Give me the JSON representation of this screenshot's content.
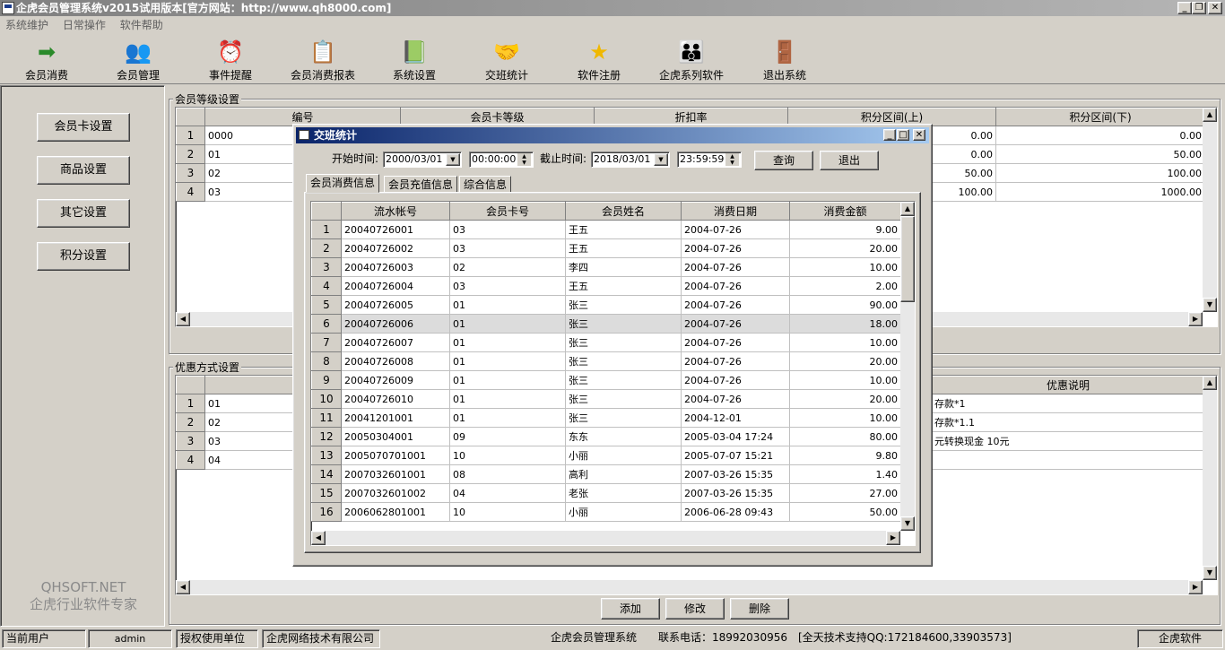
{
  "window": {
    "title": "企虎会员管理系统v2015试用版本[官方网站：http://www.qh8000.com]"
  },
  "menu": [
    "系统维护",
    "日常操作",
    "软件帮助"
  ],
  "toolbar": [
    {
      "label": "会员消费",
      "icon": "arrow-icon"
    },
    {
      "label": "会员管理",
      "icon": "users-icon"
    },
    {
      "label": "事件提醒",
      "icon": "alarm-clock-icon"
    },
    {
      "label": "会员消费报表",
      "icon": "report-icon"
    },
    {
      "label": "系统设置",
      "icon": "settings-book-icon"
    },
    {
      "label": "交班统计",
      "icon": "handshake-icon"
    },
    {
      "label": "软件注册",
      "icon": "star-icon"
    },
    {
      "label": "企虎系列软件",
      "icon": "people-group-icon"
    },
    {
      "label": "退出系统",
      "icon": "exit-door-icon"
    }
  ],
  "sidebar": {
    "buttons": [
      "会员卡设置",
      "商品设置",
      "其它设置",
      "积分设置"
    ],
    "brand1": "QHSOFT.NET",
    "brand2": "企虎行业软件专家"
  },
  "level_group": {
    "title": "会员等级设置",
    "columns": [
      "编号",
      "会员卡等级",
      "折扣率",
      "积分区间(上)",
      "积分区间(下)"
    ],
    "rows": [
      {
        "n": "1",
        "id": "0000",
        "upper": "0.00",
        "lower": "0.00"
      },
      {
        "n": "2",
        "id": "01",
        "upper": "0.00",
        "lower": "50.00"
      },
      {
        "n": "3",
        "id": "02",
        "upper": "50.00",
        "lower": "100.00"
      },
      {
        "n": "4",
        "id": "03",
        "upper": "100.00",
        "lower": "1000.00"
      }
    ]
  },
  "discount_group": {
    "title": "优惠方式设置",
    "columns": [
      "优惠说明"
    ],
    "rows": [
      {
        "n": "1",
        "id": "01",
        "desc": "存款*1"
      },
      {
        "n": "2",
        "id": "02",
        "desc": "存款*1.1"
      },
      {
        "n": "3",
        "id": "03",
        "desc": "元转换现金 10元"
      },
      {
        "n": "4",
        "id": "04",
        "desc": ""
      }
    ],
    "buttons": [
      "添加",
      "修改",
      "删除"
    ]
  },
  "dialog": {
    "title": "交班统计",
    "start_label": "开始时间:",
    "start_date": "2000/03/01",
    "start_time": "00:00:00",
    "end_label": "截止时间:",
    "end_date": "2018/03/01",
    "end_time": "23:59:59",
    "query": "查询",
    "exit": "退出",
    "tabs": [
      "会员消费信息",
      "会员充值信息",
      "综合信息"
    ],
    "columns": [
      "流水帐号",
      "会员卡号",
      "会员姓名",
      "消费日期",
      "消费金额"
    ],
    "rows": [
      [
        "1",
        "20040726001",
        "03",
        "王五",
        "2004-07-26",
        "9.00"
      ],
      [
        "2",
        "20040726002",
        "03",
        "王五",
        "2004-07-26",
        "20.00"
      ],
      [
        "3",
        "20040726003",
        "02",
        "李四",
        "2004-07-26",
        "10.00"
      ],
      [
        "4",
        "20040726004",
        "03",
        "王五",
        "2004-07-26",
        "2.00"
      ],
      [
        "5",
        "20040726005",
        "01",
        "张三",
        "2004-07-26",
        "90.00"
      ],
      [
        "6",
        "20040726006",
        "01",
        "张三",
        "2004-07-26",
        "18.00"
      ],
      [
        "7",
        "20040726007",
        "01",
        "张三",
        "2004-07-26",
        "10.00"
      ],
      [
        "8",
        "20040726008",
        "01",
        "张三",
        "2004-07-26",
        "20.00"
      ],
      [
        "9",
        "20040726009",
        "01",
        "张三",
        "2004-07-26",
        "10.00"
      ],
      [
        "10",
        "20040726010",
        "01",
        "张三",
        "2004-07-26",
        "20.00"
      ],
      [
        "11",
        "20041201001",
        "01",
        "张三",
        "2004-12-01",
        "10.00"
      ],
      [
        "12",
        "20050304001",
        "09",
        "东东",
        "2005-03-04 17:24",
        "80.00"
      ],
      [
        "13",
        "2005070701001",
        "10",
        "小丽",
        "2005-07-07 15:21",
        "9.80"
      ],
      [
        "14",
        "2007032601001",
        "08",
        "高利",
        "2007-03-26 15:35",
        "1.40"
      ],
      [
        "15",
        "2007032601002",
        "04",
        "老张",
        "2007-03-26 15:35",
        "27.00"
      ],
      [
        "16",
        "2006062801001",
        "10",
        "小丽",
        "2006-06-28 09:43",
        "50.00"
      ]
    ],
    "selected_row": 6
  },
  "status": {
    "user_label": "当前用户",
    "user": "admin",
    "auth_label": "授权使用单位",
    "company": "企虎网络技术有限公司",
    "info": "企虎会员管理系统　　联系电话：18992030956　[全天技术支持QQ:172184600,33903573]",
    "brand": "企虎软件"
  }
}
